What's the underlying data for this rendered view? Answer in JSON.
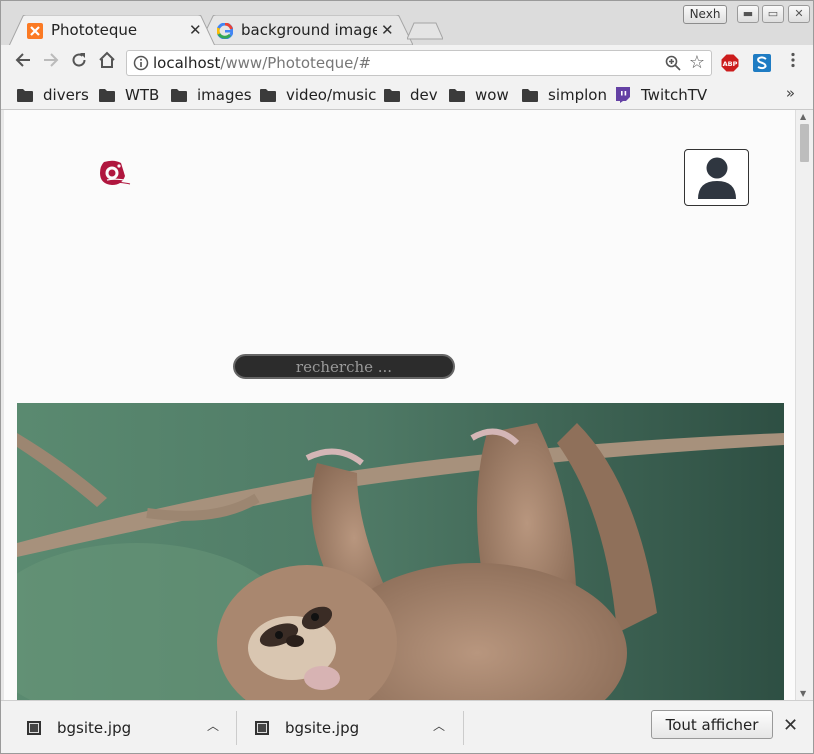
{
  "window": {
    "profile_label": "Nexh"
  },
  "tabs": [
    {
      "title": "Phototeque",
      "active": true,
      "favicon": "xampp-icon"
    },
    {
      "title": "background image",
      "active": false,
      "favicon": "google-icon"
    }
  ],
  "toolbar": {
    "url_host": "localhost",
    "url_path": "/www/Phototeque/#"
  },
  "bookmarks": [
    {
      "label": "divers",
      "icon": "folder-icon"
    },
    {
      "label": "WTB",
      "icon": "folder-icon"
    },
    {
      "label": "images",
      "icon": "folder-icon"
    },
    {
      "label": "video/music",
      "icon": "folder-icon"
    },
    {
      "label": "dev",
      "icon": "folder-icon"
    },
    {
      "label": "wow",
      "icon": "folder-icon"
    },
    {
      "label": "simplon",
      "icon": "folder-icon"
    },
    {
      "label": "TwitchTV",
      "icon": "twitch-icon"
    }
  ],
  "bookmarks_more": "»",
  "page": {
    "search_placeholder": "recherche ..."
  },
  "downloads": {
    "items": [
      {
        "name": "bgsite.jpg"
      },
      {
        "name": "bgsite.jpg"
      }
    ],
    "show_all_label": "Tout afficher"
  },
  "colors": {
    "tab_active": "#f2f2f2",
    "tab_inactive": "#e6e6e6",
    "abp_red": "#cc1d1d",
    "twitch_purple": "#6441a4",
    "logo_crimson": "#b0163e"
  }
}
